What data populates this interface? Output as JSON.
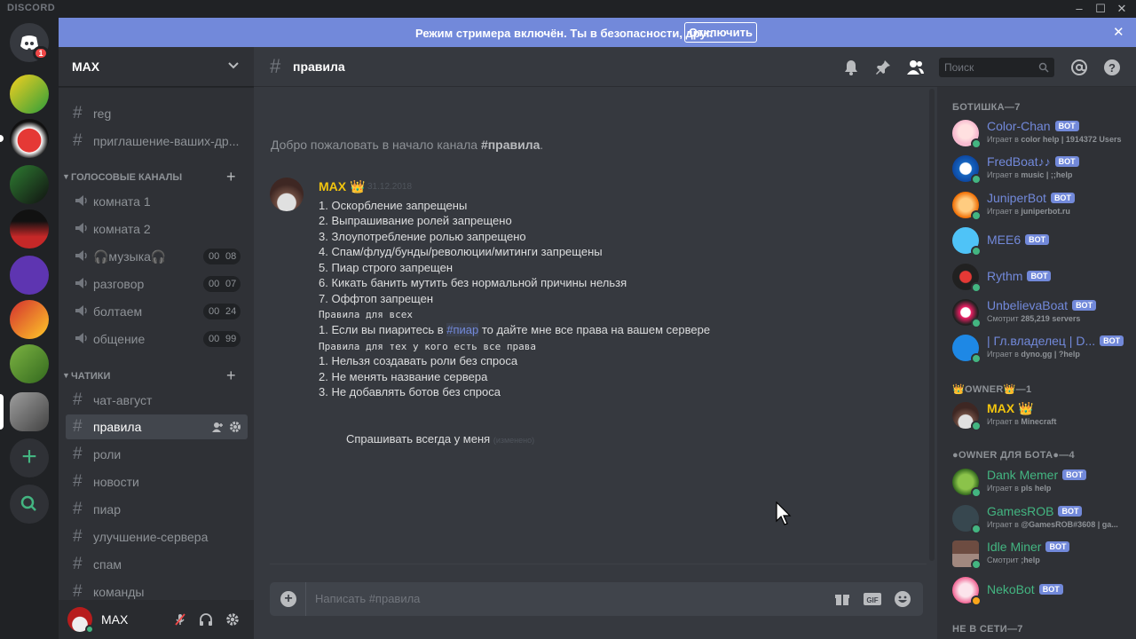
{
  "app": {
    "brand": "DISCORD"
  },
  "window": {
    "minimize": "–",
    "maximize": "☐",
    "close": "✕"
  },
  "guilds": {
    "badge_count": "1"
  },
  "banner": {
    "text": "Режим стримера включён. Ты в безопасности, друг.",
    "button": "Отключить",
    "close": "✕"
  },
  "server": {
    "name": "MAX"
  },
  "channels": {
    "top": [
      {
        "name": "reg"
      },
      {
        "name": "приглашение-ваших-др..."
      }
    ],
    "voice_category": "ГОЛОСОВЫЕ КАНАЛЫ",
    "voice": [
      {
        "name": "комната 1"
      },
      {
        "name": "комната 2"
      },
      {
        "name": "🎧музыка🎧",
        "c1": "00",
        "c2": "08"
      },
      {
        "name": "разговор",
        "c1": "00",
        "c2": "07"
      },
      {
        "name": "болтаем",
        "c1": "00",
        "c2": "24"
      },
      {
        "name": "общение",
        "c1": "00",
        "c2": "99"
      }
    ],
    "text_category": "ЧАТИКИ",
    "text": [
      {
        "name": "чат-август"
      },
      {
        "name": "правила",
        "active": true
      },
      {
        "name": "роли"
      },
      {
        "name": "новости"
      },
      {
        "name": "пиар"
      },
      {
        "name": "улучшение-сервера"
      },
      {
        "name": "спам"
      },
      {
        "name": "команды"
      }
    ]
  },
  "user_panel": {
    "username": "MAX"
  },
  "channel_header": {
    "name": "правила",
    "search_placeholder": "Поиск"
  },
  "chat": {
    "welcome_prefix": "Добро пожаловать в начало канала ",
    "welcome_channel": "#правила",
    "welcome_suffix": ".",
    "message": {
      "author": "MAX 👑",
      "timestamp": "31.12.2018",
      "lines": [
        "1. Оскорбление запрещены",
        "2. Выпрашивание ролей запрещено",
        "3. Злоупотребление ролью запрещено",
        "4. Спам/флуд/бунды/революции/митинги запрещены",
        "5. Пиар строго запрещен",
        "6. Кикать банить мутить без нормальной причины нельзя",
        "7. Оффтоп запрещен"
      ],
      "code1": "Правила для всех",
      "promo_prefix": "1. Если вы пиаритесь в ",
      "promo_mention": "#пиар",
      "promo_suffix": " то дайте мне все права на вашем сервере",
      "code2": "Правила для тех у кого есть все права",
      "lines2": [
        "1. Нельзя создавать роли без спроса",
        "2. Не менять название сервера",
        "3. Не добавлять ботов без спроса"
      ],
      "footer": "Спрашивать всегда у меня",
      "edited": "(изменено)"
    },
    "composer_placeholder": "Написать #правила"
  },
  "members": {
    "group1": "БОТИШКА—7",
    "group2": "👑OWNER👑—1",
    "group3": "●OWNER ДЛЯ БОТА●—4",
    "group4": "НЕ В СЕТИ—7",
    "bot_tag": "BOT",
    "bots": [
      {
        "name": "Color-Chan",
        "act_prefix": "Играет в ",
        "act": "color help | 1914372 Users",
        "color": "#7289da"
      },
      {
        "name": "FredBoat♪♪",
        "act_prefix": "Играет в ",
        "act": "music | ;;help",
        "color": "#7289da"
      },
      {
        "name": "JuniperBot",
        "act_prefix": "Играет в ",
        "act": "juniperbot.ru",
        "color": "#7289da"
      },
      {
        "name": "MEE6",
        "act_prefix": "",
        "act": "",
        "color": "#7289da"
      },
      {
        "name": "Rythm",
        "act_prefix": "",
        "act": "",
        "color": "#7289da"
      },
      {
        "name": "UnbelievaBoat",
        "act_prefix": "Смотрит ",
        "act": "285,219 servers",
        "color": "#7289da"
      },
      {
        "name": "| Гл.владелец | D...",
        "act_prefix": "Играет в ",
        "act": "dyno.gg | ?help",
        "color": "#7289da"
      }
    ],
    "owner": {
      "name": "MAX 👑",
      "act_prefix": "Играет в ",
      "act": "Minecraft",
      "color": "#f1c40f"
    },
    "owner_bots": [
      {
        "name": "Dank Memer",
        "act_prefix": "Играет в ",
        "act": "pls help",
        "color": "#43b581"
      },
      {
        "name": "GamesROB",
        "act_prefix": "Играет в ",
        "act": "@GamesROB#3608 | ga...",
        "color": "#43b581"
      },
      {
        "name": "Idle Miner",
        "act_prefix": "Смотрит ",
        "act": ";help",
        "color": "#43b581"
      },
      {
        "name": "NekoBot",
        "act_prefix": "",
        "act": "",
        "color": "#43b581"
      }
    ]
  }
}
